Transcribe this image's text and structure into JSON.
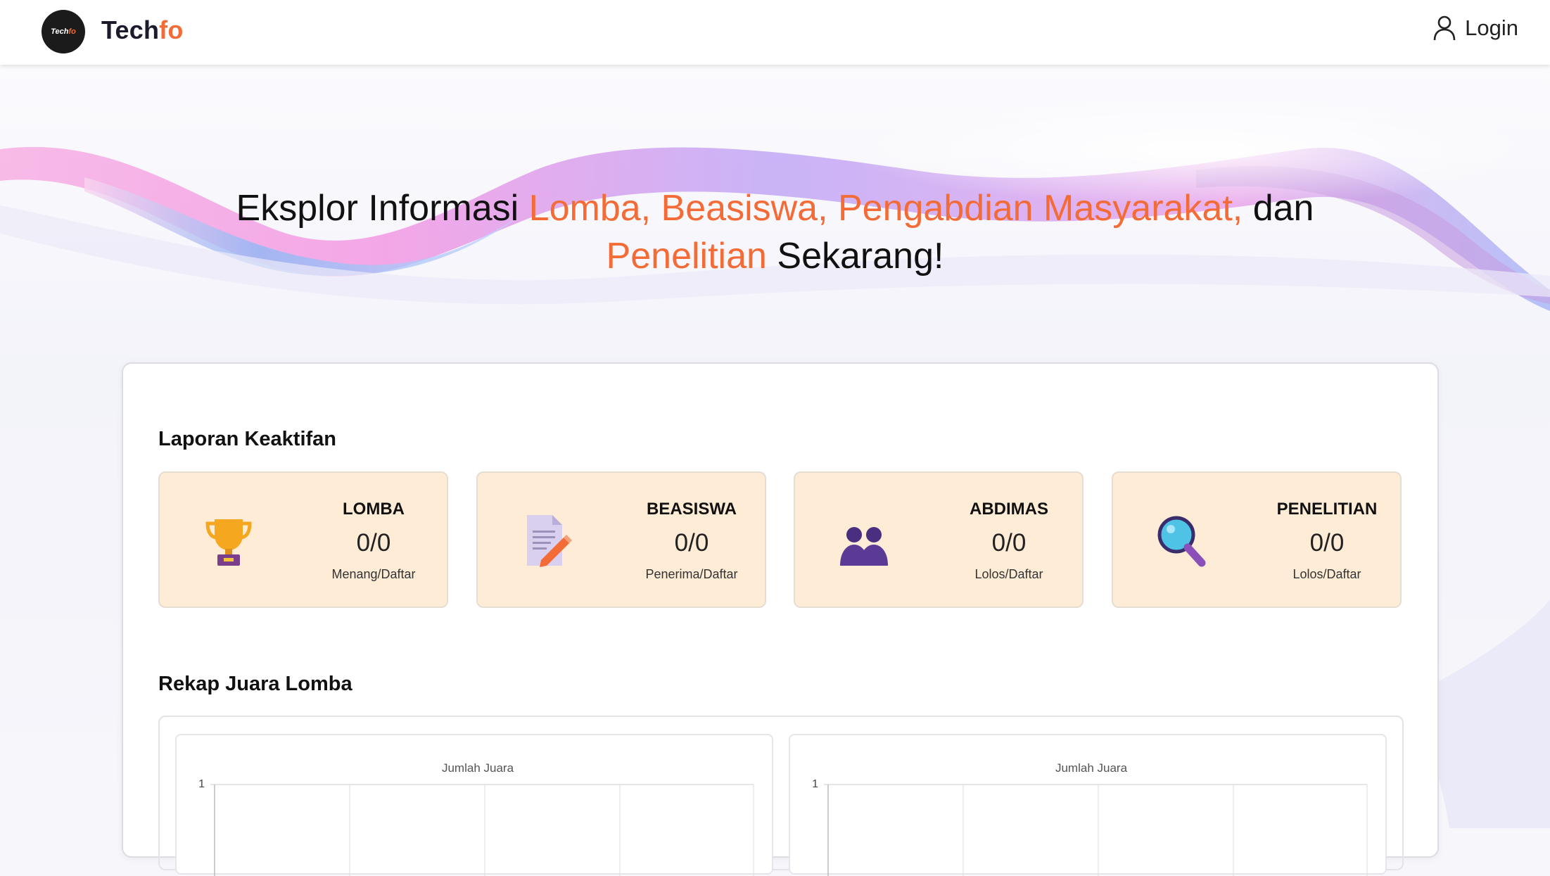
{
  "navbar": {
    "logo_text_a": "Tech",
    "logo_text_b": "fo",
    "brand_a": "Tech",
    "brand_b": "fo",
    "login_label": "Login",
    "login_icon": "user-icon"
  },
  "hero": {
    "line1_a": "Eksplor Informasi ",
    "line1_hl": "Lomba, Beasiswa, Pengabdian Masyarakat,",
    "line1_b": " dan",
    "line2_hl": "Penelitian",
    "line2_b": " Sekarang!"
  },
  "report": {
    "title": "Laporan Keaktifan",
    "cards": [
      {
        "label": "LOMBA",
        "value": "0/0",
        "sub": "Menang/Daftar",
        "icon": "trophy-icon"
      },
      {
        "label": "BEASISWA",
        "value": "0/0",
        "sub": "Penerima/Daftar",
        "icon": "document-pencil-icon"
      },
      {
        "label": "ABDIMAS",
        "value": "0/0",
        "sub": "Lolos/Daftar",
        "icon": "people-icon"
      },
      {
        "label": "PENELITIAN",
        "value": "0/0",
        "sub": "Lolos/Daftar",
        "icon": "magnifier-icon"
      }
    ]
  },
  "recap": {
    "title": "Rekap Juara Lomba"
  },
  "chart_data": [
    {
      "type": "bar",
      "title": "Jumlah Juara",
      "categories": [],
      "values": [],
      "ylim": [
        0,
        1
      ],
      "y_ticks": [
        "1"
      ]
    },
    {
      "type": "bar",
      "title": "Jumlah Juara",
      "categories": [],
      "values": [],
      "ylim": [
        0,
        1
      ],
      "y_ticks": [
        "1"
      ]
    }
  ],
  "colors": {
    "accent": "#f36b36",
    "card_bg": "#feecd6"
  }
}
